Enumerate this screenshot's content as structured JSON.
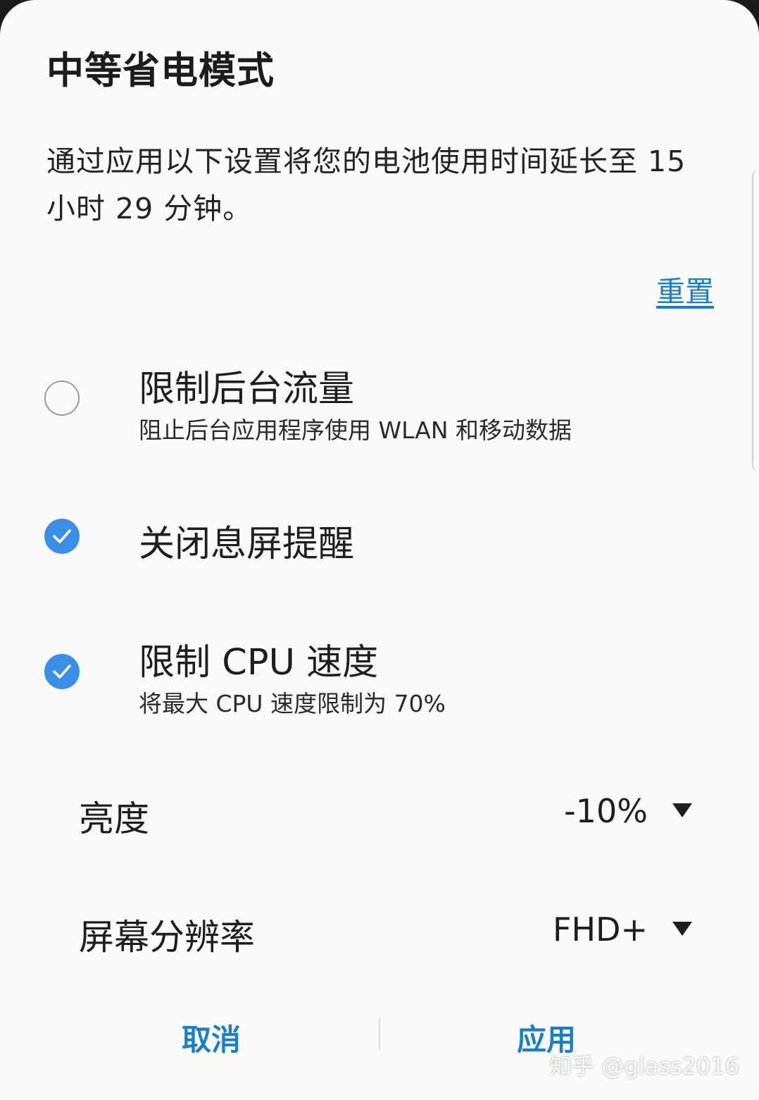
{
  "dialog": {
    "title": "中等省电模式",
    "description": "通过应用以下设置将您的电池使用时间延长至 15 小时 29 分钟。",
    "reset_label": "重置"
  },
  "options": [
    {
      "title": "限制后台流量",
      "subtitle": "阻止后台应用程序使用 WLAN 和移动数据",
      "checked": false
    },
    {
      "title": "关闭息屏提醒",
      "subtitle": "",
      "checked": true
    },
    {
      "title": "限制 CPU 速度",
      "subtitle": "将最大 CPU 速度限制为 70%",
      "checked": true
    }
  ],
  "settings": [
    {
      "label": "亮度",
      "value": "-10%"
    },
    {
      "label": "屏幕分辨率",
      "value": "FHD+"
    }
  ],
  "footer": {
    "cancel_label": "取消",
    "apply_label": "应用"
  },
  "watermark": "知乎 @glass2016",
  "colors": {
    "accent": "#1a7fc4",
    "checkbox_on": "#3b8ee8",
    "background": "#fafafa"
  }
}
